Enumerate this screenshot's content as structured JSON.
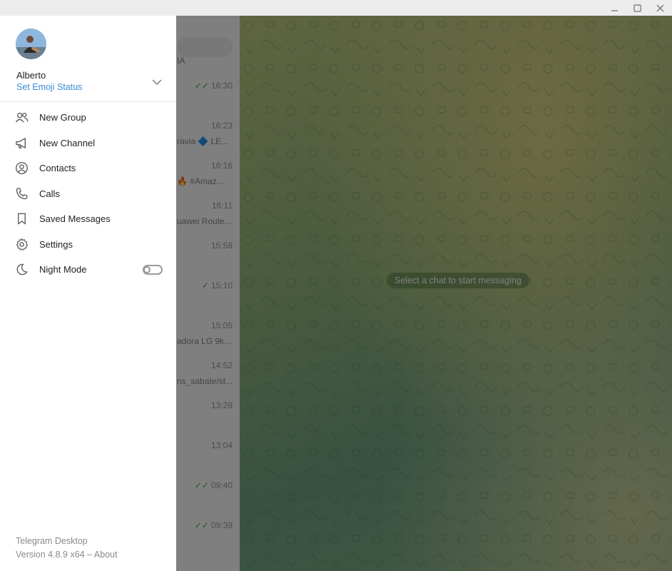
{
  "window": {
    "minimize_icon": "minimize-icon",
    "maximize_icon": "maximize-icon",
    "close_icon": "close-icon"
  },
  "drawer": {
    "user_name": "Alberto",
    "status_link": "Set Emoji Status",
    "menu": [
      {
        "label": "New Group",
        "icon": "people-icon"
      },
      {
        "label": "New Channel",
        "icon": "megaphone-icon"
      },
      {
        "label": "Contacts",
        "icon": "contact-icon"
      },
      {
        "label": "Calls",
        "icon": "phone-icon"
      },
      {
        "label": "Saved Messages",
        "icon": "bookmark-icon"
      },
      {
        "label": "Settings",
        "icon": "gear-icon"
      },
      {
        "label": "Night Mode",
        "icon": "moon-icon",
        "toggle": false
      }
    ],
    "footer_app": "Telegram Desktop",
    "footer_version": "Version 4.8.9 x64 – About"
  },
  "chatlist": {
    "rows": [
      {
        "time": "",
        "snippet": "IA",
        "check": ""
      },
      {
        "time": "16:30",
        "snippet": "",
        "check": "✓✓"
      },
      {
        "time": "16:23",
        "snippet": "ravia 🔷 LE...",
        "check": ""
      },
      {
        "time": "16:16",
        "snippet": "🔥 #Amaz...",
        "check": ""
      },
      {
        "time": "16:11",
        "snippet": "uawei Route...",
        "check": ""
      },
      {
        "time": "15:58",
        "snippet": "",
        "check": ""
      },
      {
        "time": "15:10",
        "snippet": "",
        "check": "✓"
      },
      {
        "time": "15:05",
        "snippet": "adora LG 9k...",
        "check": ""
      },
      {
        "time": "14:52",
        "snippet": "ns_sabate/st...",
        "check": ""
      },
      {
        "time": "13:28",
        "snippet": "",
        "check": ""
      },
      {
        "time": "13:04",
        "snippet": "",
        "check": ""
      },
      {
        "time": "09:40",
        "snippet": "",
        "check": "✓✓"
      },
      {
        "time": "09:39",
        "snippet": "",
        "check": "✓✓"
      }
    ]
  },
  "main": {
    "empty_message": "Select a chat to start messaging"
  },
  "colors": {
    "accent": "#3a8bd6",
    "check_green": "#4fae4e",
    "overlay": "rgba(0,0,0,0.5)"
  }
}
